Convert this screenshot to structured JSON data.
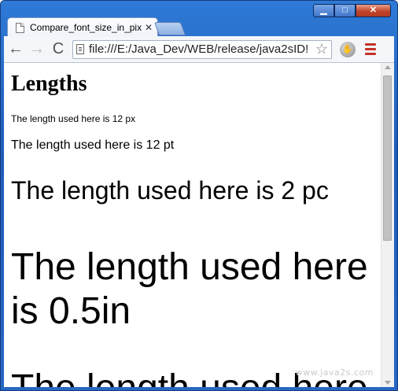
{
  "window": {
    "caption_buttons": [
      "minimize",
      "maximize",
      "close"
    ]
  },
  "tabs": [
    {
      "title": "Compare_font_size_in_pixe",
      "close_glyph": "✕",
      "favicon": "page-icon"
    }
  ],
  "toolbar": {
    "back_glyph": "←",
    "forward_glyph": "→",
    "reload_glyph": "C",
    "url": "file:///E:/Java_Dev/WEB/release/java2sID!",
    "star_glyph": "☆",
    "extension_glyph": "✋",
    "menu_icon": "hamburger-menu"
  },
  "page": {
    "heading": "Lengths",
    "lines": [
      "The length used here is 12 px",
      "The length used here is 12 pt",
      "The length used here is 2 pc",
      "The length used here is 0.5in",
      "The length used here is"
    ],
    "watermark": "www.java2s.com"
  },
  "colors": {
    "frame": "#2867c4",
    "menu_accent": "#c43027",
    "close_button": "#c0442a"
  }
}
